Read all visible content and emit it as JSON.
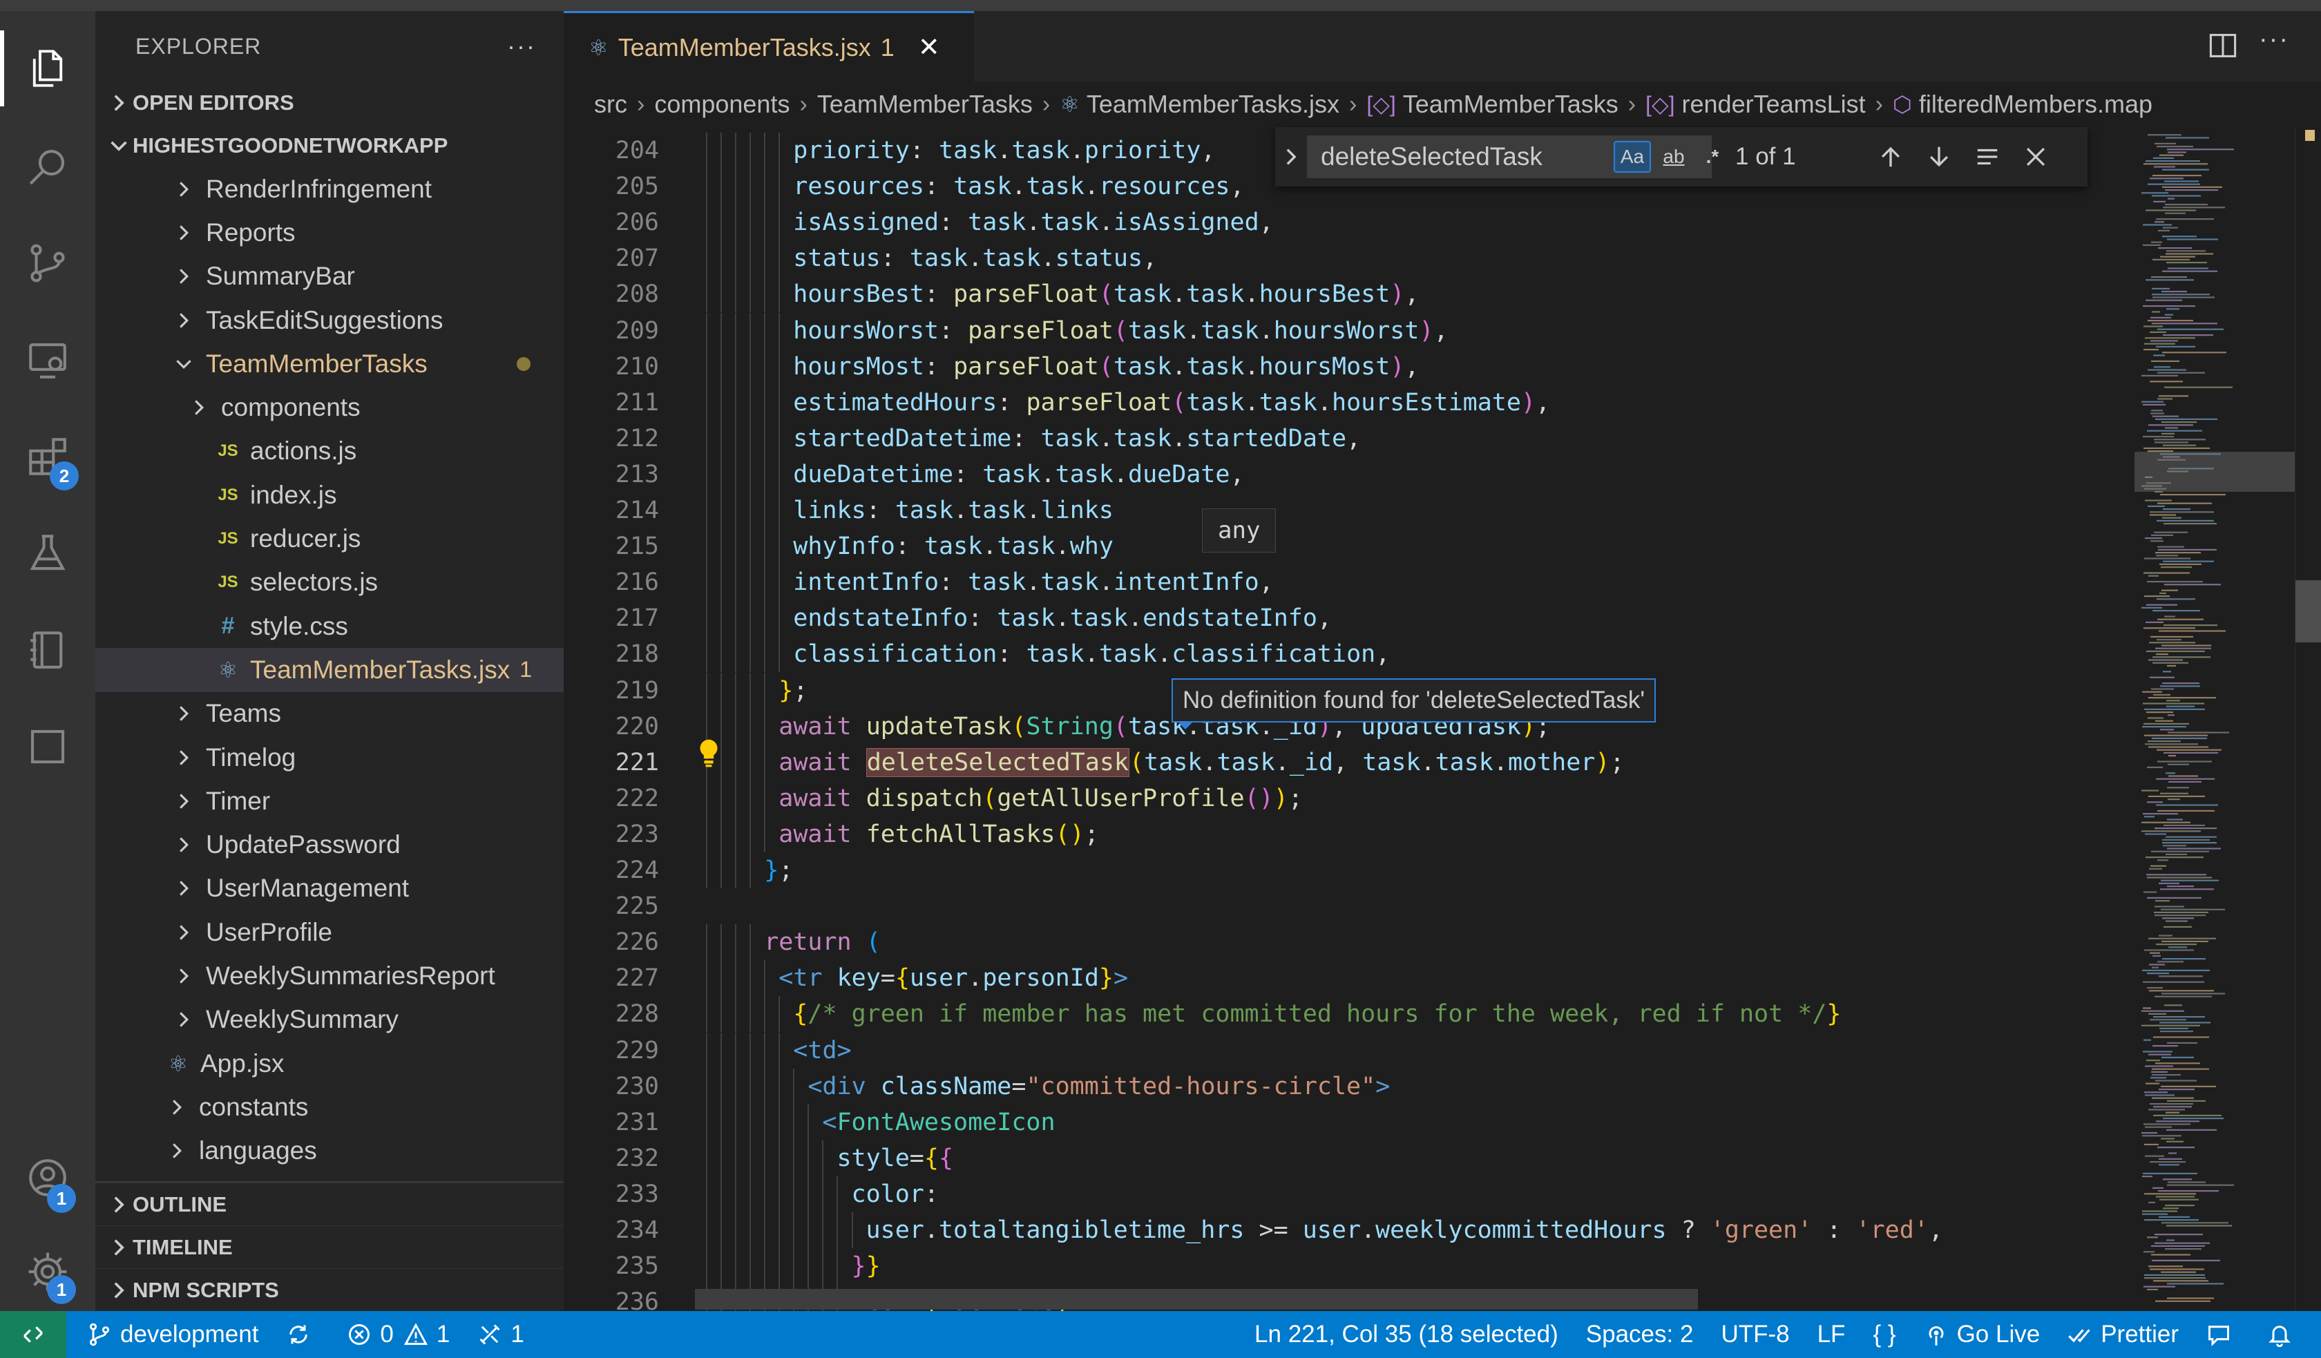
{
  "explorer": {
    "title": "EXPLORER",
    "more": "···",
    "open_editors": "OPEN EDITORS",
    "workspace": "HIGHESTGOODNETWORKAPP",
    "tree": [
      {
        "label": "RenderInfringement",
        "type": "folder",
        "level": 1
      },
      {
        "label": "Reports",
        "type": "folder",
        "level": 1
      },
      {
        "label": "SummaryBar",
        "type": "folder",
        "level": 1
      },
      {
        "label": "TaskEditSuggestions",
        "type": "folder",
        "level": 1
      },
      {
        "label": "TeamMemberTasks",
        "type": "folder-open",
        "level": 1
      },
      {
        "label": "components",
        "type": "folder",
        "level": 2
      },
      {
        "label": "actions.js",
        "type": "js",
        "level": 2
      },
      {
        "label": "index.js",
        "type": "js",
        "level": 2
      },
      {
        "label": "reducer.js",
        "type": "js",
        "level": 2
      },
      {
        "label": "selectors.js",
        "type": "js",
        "level": 2
      },
      {
        "label": "style.css",
        "type": "css",
        "level": 2
      },
      {
        "label": "TeamMemberTasks.jsx",
        "type": "jsx",
        "level": 2,
        "problems": "1"
      },
      {
        "label": "Teams",
        "type": "folder",
        "level": 1
      },
      {
        "label": "Timelog",
        "type": "folder",
        "level": 1
      },
      {
        "label": "Timer",
        "type": "folder",
        "level": 1
      },
      {
        "label": "UpdatePassword",
        "type": "folder",
        "level": 1
      },
      {
        "label": "UserManagement",
        "type": "folder",
        "level": 1
      },
      {
        "label": "UserProfile",
        "type": "folder",
        "level": 1
      },
      {
        "label": "WeeklySummariesReport",
        "type": "folder",
        "level": 1
      },
      {
        "label": "WeeklySummary",
        "type": "folder",
        "level": 1
      },
      {
        "label": "App.jsx",
        "type": "jsx",
        "level": 0
      },
      {
        "label": "constants",
        "type": "folder",
        "level": 0
      },
      {
        "label": "languages",
        "type": "folder",
        "level": 0
      }
    ],
    "bottom_sections": [
      "OUTLINE",
      "TIMELINE",
      "NPM SCRIPTS"
    ]
  },
  "activity_badges": {
    "extensions": "2",
    "accounts": "1",
    "settings": "1"
  },
  "tab": {
    "name": "TeamMemberTasks.jsx",
    "problems": "1",
    "close": "✕"
  },
  "breadcrumb": [
    "src",
    "components",
    "TeamMemberTasks",
    "TeamMemberTasks.jsx",
    "TeamMemberTasks",
    "renderTeamsList",
    "filteredMembers.map"
  ],
  "find": {
    "query": "deleteSelectedTask",
    "match_case": "Aa",
    "whole_word": "ab",
    "regex": ".*",
    "count": "1 of 1"
  },
  "hover_type": "any",
  "hover_definition": "No definition found for 'deleteSelectedTask'",
  "line_numbers": [
    "204",
    "205",
    "206",
    "207",
    "208",
    "209",
    "210",
    "211",
    "212",
    "213",
    "214",
    "215",
    "216",
    "217",
    "218",
    "219",
    "220",
    "221",
    "222",
    "223",
    "224",
    "225",
    "226",
    "227",
    "228",
    "229",
    "230",
    "231",
    "232",
    "233",
    "234",
    "235",
    "236"
  ],
  "current_line": "221",
  "code": {
    "l204": [
      "priority",
      ": ",
      "task",
      ".",
      "task",
      ".",
      "priority",
      ","
    ],
    "l205": [
      "resources",
      ": ",
      "task",
      ".",
      "task",
      ".",
      "resources",
      ","
    ],
    "l206": [
      "isAssigned",
      ": ",
      "task",
      ".",
      "task",
      ".",
      "isAssigned",
      ","
    ],
    "l207": [
      "status",
      ": ",
      "task",
      ".",
      "task",
      ".",
      "status",
      ","
    ],
    "l208": [
      "hoursBest",
      ": ",
      "parseFloat",
      "(",
      "task",
      ".",
      "task",
      ".",
      "hoursBest",
      ")",
      ","
    ],
    "l209": [
      "hoursWorst",
      ": ",
      "parseFloat",
      "(",
      "task",
      ".",
      "task",
      ".",
      "hoursWorst",
      ")",
      ","
    ],
    "l210": [
      "hoursMost",
      ": ",
      "parseFloat",
      "(",
      "task",
      ".",
      "task",
      ".",
      "hoursMost",
      ")",
      ","
    ],
    "l211": [
      "estimatedHours",
      ": ",
      "parseFloat",
      "(",
      "task",
      ".",
      "task",
      ".",
      "hoursEstimate",
      ")",
      ","
    ],
    "l212": [
      "startedDatetime",
      ": ",
      "task",
      ".",
      "task",
      ".",
      "startedDate",
      ","
    ],
    "l213": [
      "dueDatetime",
      ": ",
      "task",
      ".",
      "task",
      ".",
      "dueDate",
      ","
    ],
    "l214": [
      "links",
      ": ",
      "task",
      ".",
      "task",
      ".",
      "links"
    ],
    "l215": [
      "whyInfo",
      ": ",
      "task",
      ".",
      "task",
      ".",
      "why"
    ],
    "l216": [
      "intentInfo",
      ": ",
      "task",
      ".",
      "task",
      ".",
      "intentInfo",
      ","
    ],
    "l217": [
      "endstateInfo",
      ": ",
      "task",
      ".",
      "task",
      ".",
      "endstateInfo",
      ","
    ],
    "l218": [
      "classification",
      ": ",
      "task",
      ".",
      "task",
      ".",
      "classification",
      ","
    ],
    "l219": [
      "}",
      ";"
    ],
    "l220": [
      "await",
      " ",
      "updateTask",
      "(",
      "String",
      "(",
      "task",
      ".",
      "task",
      ".",
      "_id",
      ")",
      ", ",
      "updatedTask",
      ")",
      ";"
    ],
    "l221": [
      "await",
      " ",
      "deleteSelectedTask",
      "(",
      "task",
      ".",
      "task",
      ".",
      "_id",
      ", ",
      "task",
      ".",
      "task",
      ".",
      "mother",
      ")",
      ";"
    ],
    "l222": [
      "await",
      " ",
      "dispatch",
      "(",
      "getAllUserProfile",
      "()",
      ")",
      ";"
    ],
    "l223": [
      "await",
      " ",
      "fetchAllTasks",
      "()",
      ";"
    ],
    "l224": [
      "}",
      ";"
    ],
    "l226": [
      "return",
      " ",
      "("
    ],
    "l227": [
      "<",
      "tr",
      " ",
      "key",
      "=",
      "{",
      "user",
      ".",
      "personId",
      "}",
      ">"
    ],
    "l228": [
      "{",
      "/* green if member has met committed hours for the week, red if not */",
      "}"
    ],
    "l229": [
      "<",
      "td",
      ">"
    ],
    "l230": [
      "<",
      "div",
      " ",
      "className",
      "=",
      "\"committed-hours-circle\"",
      ">"
    ],
    "l231": [
      "<",
      "FontAwesomeIcon"
    ],
    "l232": [
      "style",
      "=",
      "{",
      "{"
    ],
    "l233": [
      "color",
      ":"
    ],
    "l234": [
      "user",
      ".",
      "totaltangibletime_hrs",
      " >= ",
      "user",
      ".",
      "weeklycommittedHours",
      " ? ",
      "'green'",
      " : ",
      "'red'",
      ","
    ],
    "l235": [
      "}",
      "}"
    ],
    "l236": [
      "icon",
      "=",
      "{",
      "faCircle",
      "}"
    ]
  },
  "status": {
    "branch": "development",
    "errors": "0",
    "warnings": "1",
    "ports": "1",
    "position": "Ln 221, Col 35 (18 selected)",
    "spaces": "Spaces: 2",
    "encoding": "UTF-8",
    "eol": "LF",
    "language": "{ }",
    "golive": "Go Live",
    "prettier": "Prettier"
  },
  "colors": {
    "accent": "#007acc",
    "modified": "#e2c08d",
    "remote": "#16825d"
  }
}
